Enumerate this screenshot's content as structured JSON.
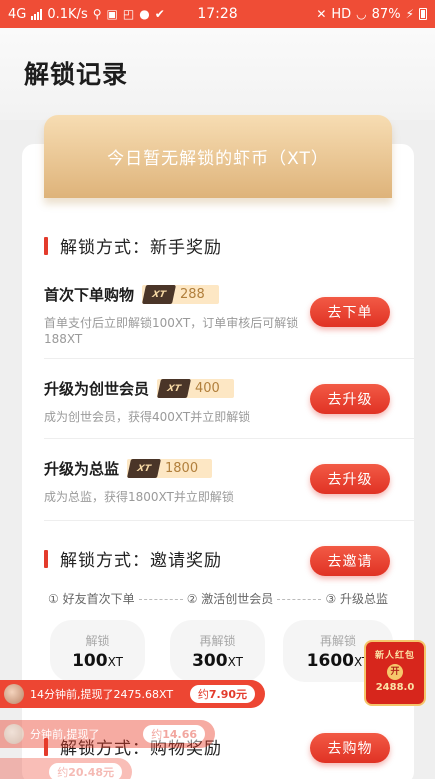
{
  "status_bar": {
    "network": "4G",
    "speed": "0.1K/s",
    "time": "17:28",
    "hd": "HD",
    "battery": "87%"
  },
  "page": {
    "title": "解锁记录"
  },
  "banner": {
    "text": "今日暂无解锁的虾币（XT）"
  },
  "sections": [
    {
      "title": "解锁方式：新手奖励"
    },
    {
      "title": "解锁方式：邀请奖励",
      "button": "去邀请"
    },
    {
      "title": "解锁方式：购物奖励",
      "button": "去购物"
    }
  ],
  "tasks": [
    {
      "name": "首次下单购物",
      "tag": "XT",
      "amount": "288",
      "desc": "首单支付后立即解锁100XT，订单审核后可解锁188XT",
      "button": "去下单"
    },
    {
      "name": "升级为创世会员",
      "tag": "XT",
      "amount": "400",
      "desc": "成为创世会员，获得400XT并立即解锁",
      "button": "去升级"
    },
    {
      "name": "升级为总监",
      "tag": "XT",
      "amount": "1800",
      "desc": "成为总监，获得1800XT并立即解锁",
      "button": "去升级"
    }
  ],
  "invite": {
    "steps": [
      "① 好友首次下单",
      "② 激活创世会员",
      "③ 升级总监"
    ],
    "rewards": [
      {
        "label": "解锁",
        "value": "100",
        "unit": "XT"
      },
      {
        "label": "再解锁",
        "value": "300",
        "unit": "XT"
      },
      {
        "label": "再解锁",
        "value": "1600",
        "unit": "XT"
      }
    ]
  },
  "red_envelope": {
    "title": "新人红包",
    "coin": "开",
    "amount": "2488.0"
  },
  "toasts": [
    {
      "text": "14分钟前,提现了2475.68XT",
      "pill_prefix": "约",
      "pill_value": "7.90元"
    },
    {
      "text": "分钟前,提现了",
      "pill_prefix": "约",
      "pill_value": "14.66"
    },
    {
      "text": "",
      "pill_prefix": "约",
      "pill_value": "20.48元"
    }
  ],
  "colors": {
    "accent": "#e33b2c",
    "banner_gold": "#deb37a",
    "xt_dark": "#4a3528"
  }
}
